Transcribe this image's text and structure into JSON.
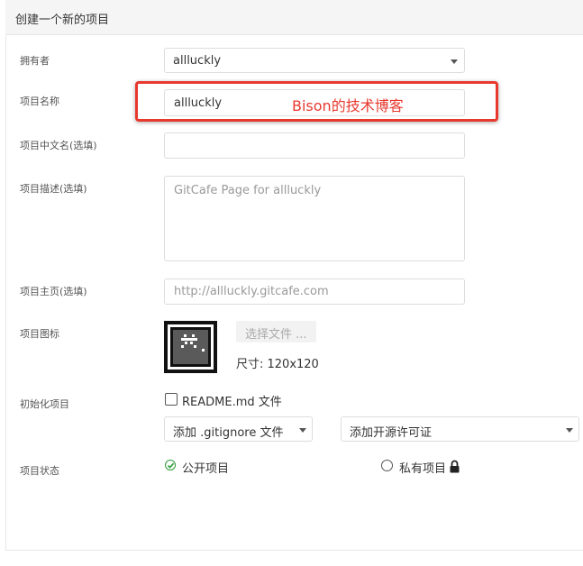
{
  "header": {
    "title": "创建一个新的项目"
  },
  "form": {
    "owner": {
      "label": "拥有者",
      "value": "allluckly"
    },
    "name": {
      "label": "项目名称",
      "value": "allluckly"
    },
    "annotation": "Bison的技术博客",
    "cn_name": {
      "label": "项目中文名(选填)",
      "value": ""
    },
    "description": {
      "label": "项目描述(选填)",
      "placeholder": "GitCafe Page for allluckly"
    },
    "homepage": {
      "label": "项目主页(选填)",
      "placeholder": "http://allluckly.gitcafe.com"
    },
    "icon": {
      "label": "项目图标",
      "choose_file": "选择文件 ...",
      "size_text": "尺寸: 120x120"
    },
    "init": {
      "label": "初始化项目",
      "readme_label": "README.md 文件",
      "gitignore_select": "添加 .gitignore 文件",
      "license_select": "添加开源许可证"
    },
    "visibility": {
      "label": "项目状态",
      "public_label": "公开项目",
      "private_label": "私有项目"
    }
  },
  "colors": {
    "accent_red": "#e8392f",
    "check_green": "#2c9a3a"
  }
}
